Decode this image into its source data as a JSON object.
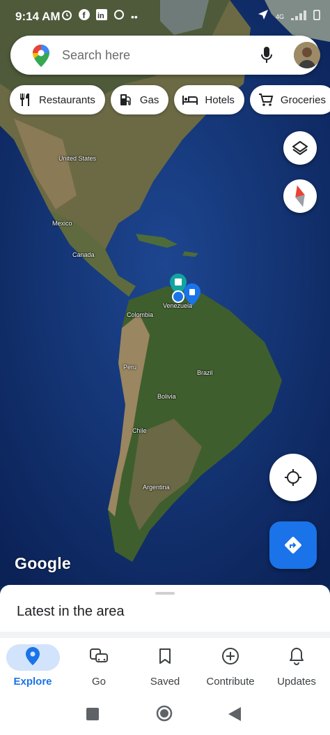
{
  "status_bar": {
    "time": "9:14 AM",
    "left_icons": [
      "alarm-icon",
      "facebook-icon",
      "linkedin-icon",
      "pinwheel-icon",
      "more-dots-icon"
    ],
    "network": "4G",
    "right_icons": [
      "location-arrow-icon",
      "signal-icon",
      "signal-icon-2",
      "battery-icon"
    ]
  },
  "search": {
    "placeholder": "Search here",
    "icons": [
      "maps-pin-icon",
      "microphone-icon",
      "avatar"
    ]
  },
  "chips": [
    {
      "label": "Restaurants",
      "icon": "fork-knife-icon"
    },
    {
      "label": "Gas",
      "icon": "gas-pump-icon"
    },
    {
      "label": "Hotels",
      "icon": "bed-icon"
    },
    {
      "label": "Groceries",
      "icon": "cart-icon"
    }
  ],
  "map": {
    "labels": {
      "canada": "Canada",
      "united_states": "United States",
      "mexico": "Mexico",
      "venezuela": "Venezuela",
      "colombia": "Colombia",
      "peru": "Peru",
      "brazil": "Brazil",
      "bolivia": "Bolivia",
      "chile": "Chile",
      "argentina": "Argentina"
    },
    "watermark": "Google",
    "controls": [
      "layers-icon",
      "compass-icon",
      "my-location-icon",
      "directions-icon"
    ]
  },
  "sheet": {
    "title": "Latest in the area"
  },
  "bottom_nav": {
    "items": [
      {
        "label": "Explore",
        "icon": "location-pin-icon",
        "active": true
      },
      {
        "label": "Go",
        "icon": "commute-icon",
        "active": false
      },
      {
        "label": "Saved",
        "icon": "bookmark-icon",
        "active": false
      },
      {
        "label": "Contribute",
        "icon": "add-circle-icon",
        "active": false
      },
      {
        "label": "Updates",
        "icon": "bell-icon",
        "active": false
      }
    ]
  },
  "system_nav": [
    "recents-button",
    "home-button",
    "back-button"
  ],
  "colors": {
    "accent": "#1a73e8",
    "active_pill": "#d2e3fc",
    "ocean": "#16387a"
  }
}
